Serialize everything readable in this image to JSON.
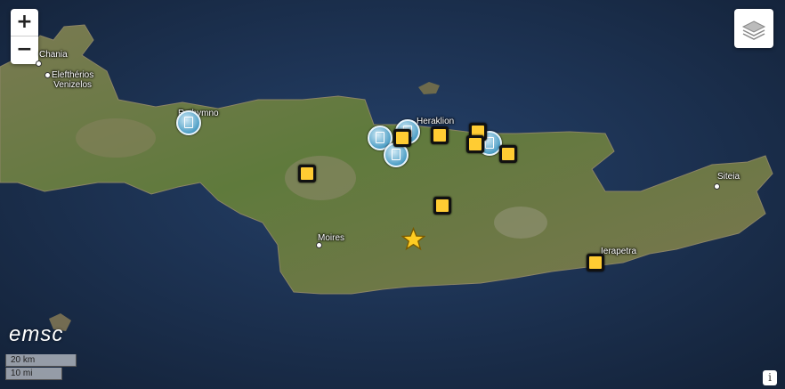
{
  "controls": {
    "zoom_in": "+",
    "zoom_out": "−",
    "info": "i",
    "layers_icon": "layers-icon"
  },
  "places": [
    {
      "key": "chania",
      "name": "Chania"
    },
    {
      "key": "elefth",
      "name": "Elefthérios\nVenizelos"
    },
    {
      "key": "rethymno",
      "name": "Rethymno"
    },
    {
      "key": "heraklion",
      "name": "Heraklion"
    },
    {
      "key": "moires",
      "name": "Moires"
    },
    {
      "key": "sitia",
      "name": "Siteia"
    },
    {
      "key": "ierapetra",
      "name": "Ierapetra"
    }
  ],
  "logo": "emsc",
  "scale": {
    "metric": "20 km",
    "imperial": "10 mi"
  },
  "markers": {
    "note_count": 9,
    "query_count": 5,
    "star_count": 1
  },
  "colors": {
    "sea": "#1d3150",
    "land": "#6d7e45",
    "note": "#ffcc33",
    "query": "#4f9fc6"
  }
}
